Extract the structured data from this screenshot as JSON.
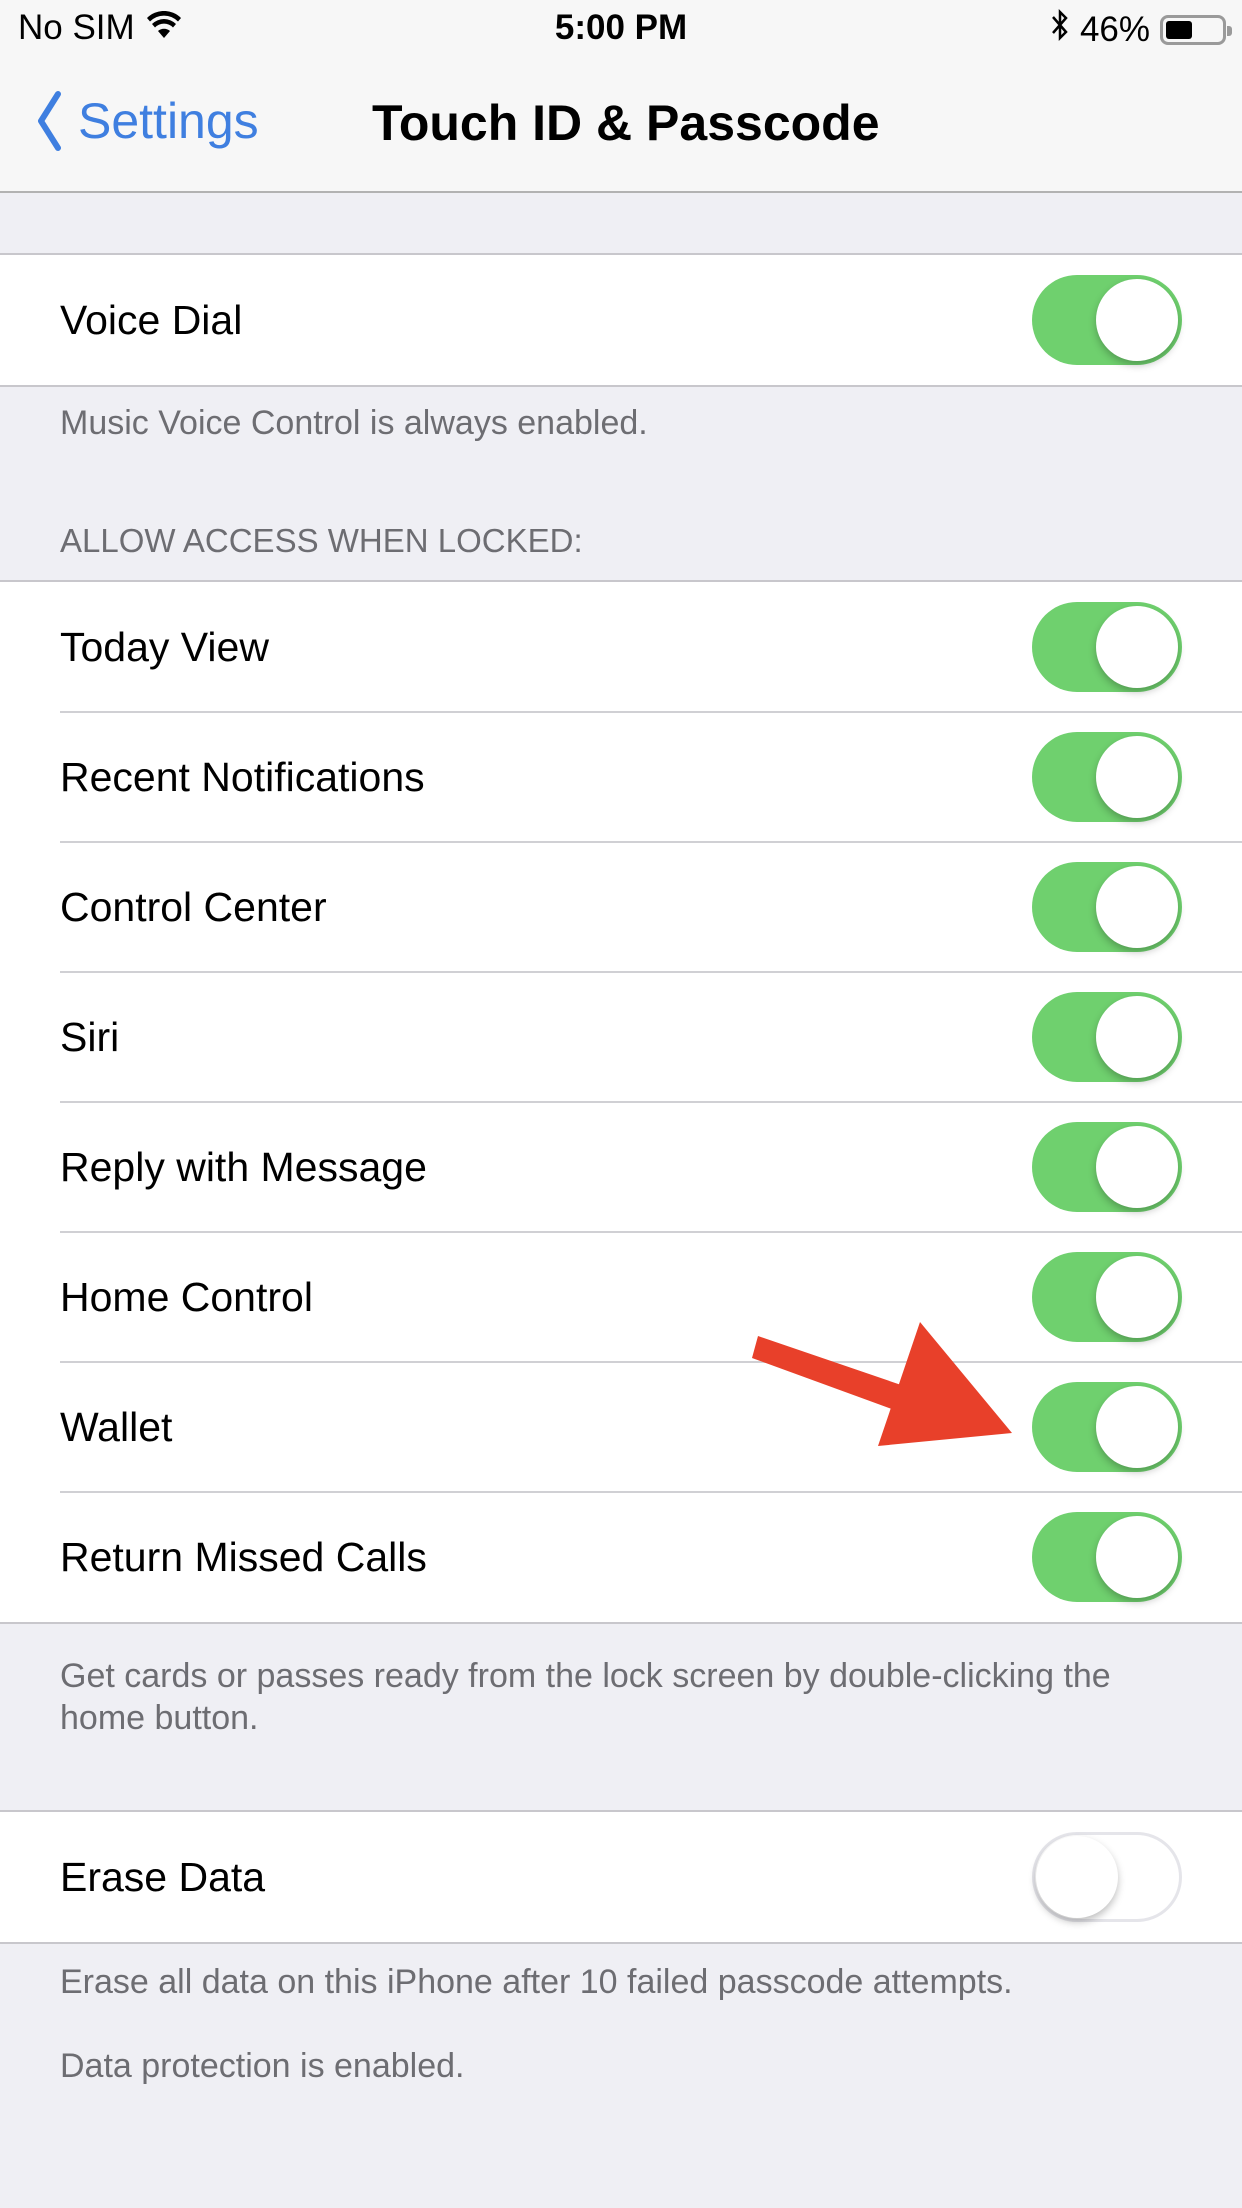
{
  "status_bar": {
    "carrier": "No SIM",
    "wifi_icon": "wifi-icon",
    "time": "5:00 PM",
    "bluetooth_icon": "bluetooth-icon",
    "battery_percent": "46%",
    "battery_level": 0.46
  },
  "nav": {
    "back_label": "Settings",
    "title": "Touch ID & Passcode"
  },
  "voice_group": {
    "rows": [
      {
        "label": "Voice Dial",
        "on": true
      }
    ],
    "footer": "Music Voice Control is always enabled."
  },
  "locked_group": {
    "header": "ALLOW ACCESS WHEN LOCKED:",
    "rows": [
      {
        "label": "Today View",
        "on": true
      },
      {
        "label": "Recent Notifications",
        "on": true
      },
      {
        "label": "Control Center",
        "on": true
      },
      {
        "label": "Siri",
        "on": true
      },
      {
        "label": "Reply with Message",
        "on": true
      },
      {
        "label": "Home Control",
        "on": true
      },
      {
        "label": "Wallet",
        "on": true
      },
      {
        "label": "Return Missed Calls",
        "on": true
      }
    ],
    "footer": "Get cards or passes ready from the lock screen by double-clicking the home button."
  },
  "erase_group": {
    "rows": [
      {
        "label": "Erase Data",
        "on": false
      }
    ],
    "footer_1": "Erase all data on this iPhone after 10 failed passcode attempts.",
    "footer_2": "Data protection is enabled."
  },
  "annotation": {
    "type": "arrow",
    "color": "#e8402a",
    "points_to": "Wallet toggle"
  },
  "colors": {
    "toggle_on": "#6fd06e",
    "link_blue": "#3f7fe0",
    "background": "#efeff4"
  }
}
